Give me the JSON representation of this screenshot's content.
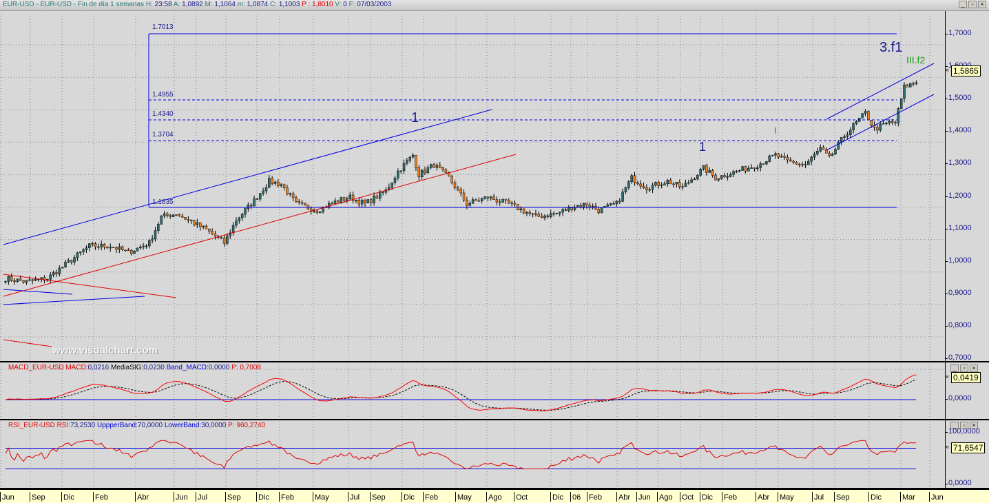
{
  "title": {
    "symbol": "EUR-USD - EUR-USD - Fin de día 1 semanas",
    "h_label": "H:",
    "h": "23:58",
    "a_label": "A:",
    "a": "1,0892",
    "m_label": "M:",
    "m": "1,1064",
    "lo_label": "m:",
    "lo": "1,0874",
    "c_label": "C:",
    "c": "1,1003",
    "p": "P : 1,8010",
    "v_label": "V:",
    "v": "0",
    "f_label": "F:",
    "f": "07/03/2003"
  },
  "window_buttons": {
    "minimize": "_",
    "restore": "▫",
    "close": "×"
  },
  "price_axis": {
    "labels": [
      "1,7000",
      "1,6000",
      "1,5000",
      "1,4000",
      "1,3000",
      "1,2000",
      "1,1000",
      "1,0000",
      "0,9000",
      "0,8000",
      "0,7000"
    ],
    "last": "1,5865"
  },
  "fib_labels": [
    "1.7013",
    "1.4955",
    "1.4340",
    "1.3704",
    "1.1635"
  ],
  "wave_labels": {
    "w1a": "1",
    "w1b": "1",
    "wI": "I",
    "w3f1": "3.f1",
    "wIIIf2": "III.f2"
  },
  "watermark": "www.visualchart.com",
  "macd": {
    "name": "MACD_EUR-USD",
    "macd_label": "MACD:",
    "macd": "0,0216",
    "sig_label": "MediaSIG:",
    "sig": "0,0230",
    "band_label": "Band_MACD:",
    "band": "0,0000",
    "p": "P: 0,7008",
    "axis_zero": "0,0000",
    "last": "0,0419"
  },
  "rsi": {
    "name": "RSI_EUR-USD",
    "rsi_label": "RSI:",
    "rsi": "73,2530",
    "upper_label": "UppperBand:",
    "upper": "70,0000",
    "lower_label": "LowerBand:",
    "lower": "30,0000",
    "p": "P: 960,2740",
    "axis_top": "100,0000",
    "axis_zero": "0,0000",
    "last": "71,6547"
  },
  "dates": [
    "Jun",
    "Sep",
    "Dic",
    "Feb",
    "Abr",
    "Jun",
    "Jul",
    "Sep",
    "Dic",
    "Feb",
    "May",
    "Jul",
    "Sep",
    "Dic",
    "Feb",
    "May",
    "Ago",
    "Oct",
    "Dic",
    "06",
    "Feb",
    "Abr",
    "Jun",
    "Ago",
    "Oct",
    "Dic",
    "Feb",
    "Abr",
    "May",
    "Jul",
    "Sep",
    "Dic",
    "Mar",
    "Jun"
  ],
  "colors": {
    "up": "#2f6f6f",
    "down": "#f08020",
    "line": "#0000e0",
    "macd": "#ff0000",
    "rsi": "#e00000"
  },
  "price_series": [
    [
      0,
      0.98
    ],
    [
      7,
      0.97
    ],
    [
      14,
      0.98
    ],
    [
      21,
      1.03
    ],
    [
      28,
      1.08
    ],
    [
      35,
      1.08
    ],
    [
      38,
      1.07
    ],
    [
      41,
      1.06
    ],
    [
      48,
      1.09
    ],
    [
      52,
      1.17
    ],
    [
      57,
      1.18
    ],
    [
      63,
      1.15
    ],
    [
      67,
      1.13
    ],
    [
      73,
      1.09
    ],
    [
      77,
      1.16
    ],
    [
      83,
      1.22
    ],
    [
      88,
      1.28
    ],
    [
      92,
      1.27
    ],
    [
      97,
      1.21
    ],
    [
      104,
      1.19
    ],
    [
      111,
      1.22
    ],
    [
      115,
      1.23
    ],
    [
      120,
      1.21
    ],
    [
      127,
      1.25
    ],
    [
      131,
      1.31
    ],
    [
      136,
      1.36
    ],
    [
      138,
      1.3
    ],
    [
      143,
      1.33
    ],
    [
      148,
      1.29
    ],
    [
      154,
      1.21
    ],
    [
      161,
      1.23
    ],
    [
      168,
      1.21
    ],
    [
      177,
      1.17
    ],
    [
      184,
      1.18
    ],
    [
      189,
      1.2
    ],
    [
      194,
      1.21
    ],
    [
      198,
      1.19
    ],
    [
      204,
      1.21
    ],
    [
      209,
      1.29
    ],
    [
      214,
      1.26
    ],
    [
      221,
      1.28
    ],
    [
      226,
      1.26
    ],
    [
      233,
      1.32
    ],
    [
      237,
      1.29
    ],
    [
      244,
      1.31
    ],
    [
      251,
      1.33
    ],
    [
      257,
      1.36
    ],
    [
      261,
      1.34
    ],
    [
      267,
      1.33
    ],
    [
      272,
      1.38
    ],
    [
      275,
      1.35
    ],
    [
      280,
      1.42
    ],
    [
      287,
      1.49
    ],
    [
      290,
      1.44
    ],
    [
      295,
      1.46
    ],
    [
      297,
      1.46
    ],
    [
      300,
      1.57
    ],
    [
      304,
      1.585
    ]
  ]
}
